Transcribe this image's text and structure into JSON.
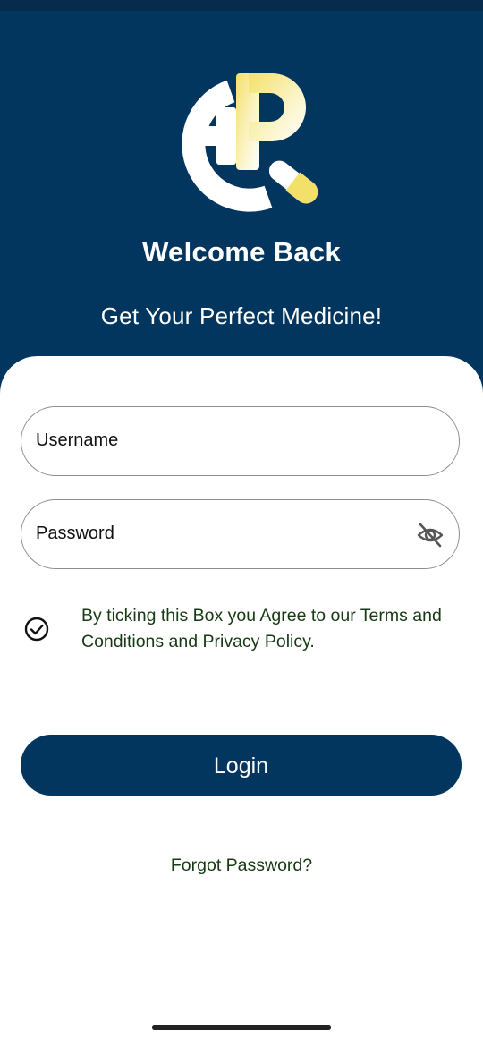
{
  "header": {
    "title": "Welcome Back",
    "subtitle": "Get Your Perfect Medicine!"
  },
  "form": {
    "username_label": "Username",
    "password_label": "Password",
    "terms_text": "By ticking this Box you Agree to our Terms and Conditions and Privacy Policy.",
    "terms_checked": true,
    "login_label": "Login",
    "forgot_label": "Forgot Password?"
  },
  "icons": {
    "logo": "medicine-logo-icon",
    "password_toggle": "eye-off-icon",
    "terms_checkbox": "check-circle-icon"
  },
  "colors": {
    "primary": "#02365f",
    "accent_yellow": "#f3e06a",
    "text_green": "#163a14"
  }
}
